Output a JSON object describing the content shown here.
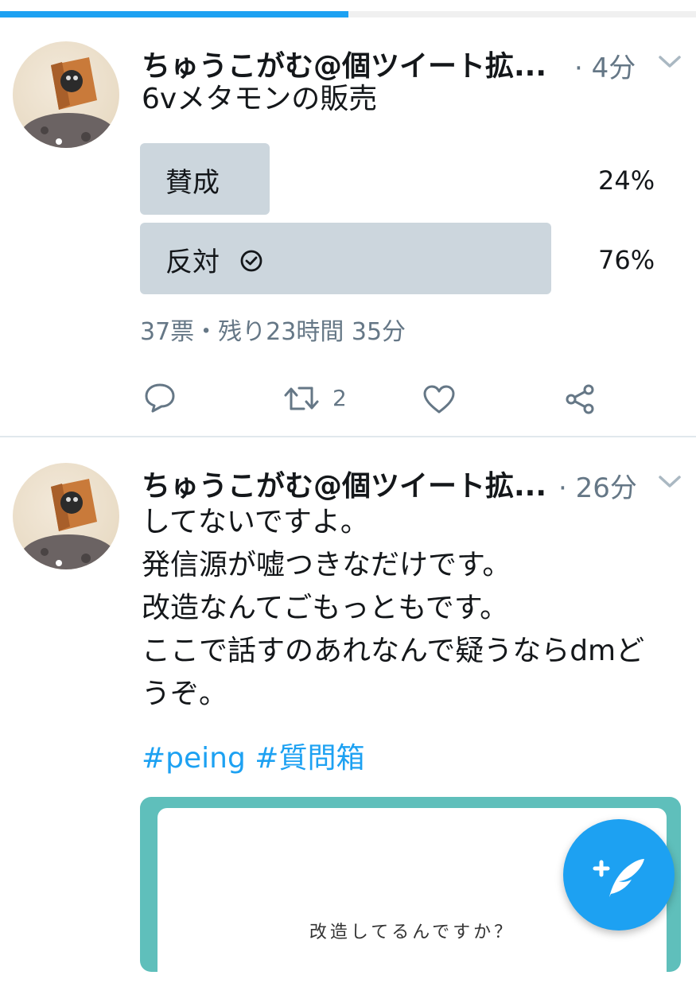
{
  "progress": {
    "fraction": 0.5
  },
  "tweets": [
    {
      "handle": "ちゅうこがむ@個ツイート拡...",
      "time": "· 4分",
      "text": "6vメタモンの販売",
      "poll": {
        "options": [
          {
            "label": "賛成",
            "percent_text": "24%",
            "percent": 24
          },
          {
            "label": "反対",
            "percent_text": "76%",
            "percent": 76,
            "selected": true
          }
        ],
        "meta": "37票・残り23時間 35分"
      },
      "actions": {
        "retweet_count": "2",
        "icons": [
          "reply-icon",
          "retweet-icon",
          "like-icon",
          "share-icon"
        ]
      }
    },
    {
      "handle": "ちゅうこがむ@個ツイート拡...",
      "time": "· 26分",
      "text": "してないですよ。\n発信源が嘘つきなだけです。\n改造なんてごもっともです。\nここで話すのあれなんで疑うならdmど\nうぞ。",
      "hashtags": "#peing #質問箱",
      "card": {
        "text": "改造してるんですか？"
      }
    }
  ],
  "fab": {
    "icon": "compose-tweet-icon"
  },
  "colors": {
    "accent": "#1da1f2",
    "poll_fill": "#ccd6dd",
    "muted": "#657786",
    "card_border": "#5fbfbb"
  }
}
